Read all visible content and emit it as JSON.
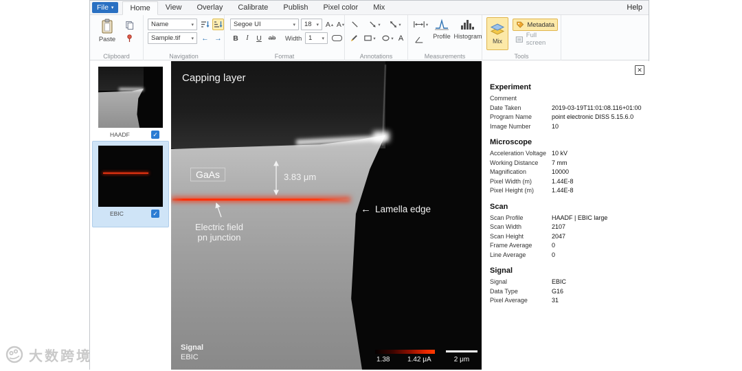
{
  "window": {
    "help_label": "Help"
  },
  "icons": {
    "caret": "▾",
    "caret_up": "▴",
    "arrow_left": "←",
    "arrow_right": "→",
    "check": "✓",
    "close": "✕"
  },
  "file_menu": {
    "label": "File"
  },
  "tabs": {
    "items": [
      "Home",
      "View",
      "Overlay",
      "Calibrate",
      "Publish",
      "Pixel color",
      "Mix"
    ],
    "active": "Home"
  },
  "ribbon": {
    "clipboard": {
      "group_label": "Clipboard",
      "paste_label": "Paste"
    },
    "navigation": {
      "group_label": "Navigation",
      "sort_field": "Name",
      "file_name": "Sample.tif"
    },
    "format": {
      "group_label": "Format",
      "font_family": "Segoe UI",
      "font_size": "18",
      "bold": "B",
      "italic": "I",
      "underline": "U",
      "strikethrough": "ab",
      "grow": "A",
      "shrink": "A",
      "width_label": "Width",
      "width_value": "1"
    },
    "annotations": {
      "group_label": "Annotations",
      "text_tool": "A"
    },
    "measurements": {
      "group_label": "Measurements",
      "profile_label": "Profile",
      "histogram_label": "Histogram"
    },
    "tools": {
      "group_label": "Tools",
      "mix_label": "Mix",
      "metadata_label": "Metadata",
      "fullscreen_label": "Full screen"
    }
  },
  "thumbnails": [
    {
      "name": "HAADF",
      "checked": true,
      "selected": false
    },
    {
      "name": "EBIC",
      "checked": true,
      "selected": true
    }
  ],
  "image": {
    "capping_label": "Capping layer",
    "gaas_label": "GaAs",
    "measurement_value": "3.83 μm",
    "efield_line1": "Electric field",
    "efield_line2": "pn junction",
    "lamella_label": "Lamella edge",
    "signal_title": "Signal",
    "signal_value": "EBIC",
    "colorbar_min": "1.38",
    "colorbar_max": "1.42 μA",
    "scalebar_label": "2 μm"
  },
  "metadata_panel": {
    "sections": [
      {
        "title": "Experiment",
        "rows": [
          {
            "label": "Comment",
            "value": ""
          },
          {
            "label": "Date Taken",
            "value": "2019-03-19T11:01:08.116+01:00"
          },
          {
            "label": "Program Name",
            "value": "point electronic DISS 5.15.6.0"
          },
          {
            "label": "Image Number",
            "value": "10"
          }
        ]
      },
      {
        "title": "Microscope",
        "rows": [
          {
            "label": "Acceleration Voltage",
            "value": "10 kV"
          },
          {
            "label": "Working Distance",
            "value": "7 mm"
          },
          {
            "label": "Magnification",
            "value": "10000"
          },
          {
            "label": "Pixel Width (m)",
            "value": "1.44E-8"
          },
          {
            "label": "Pixel Height (m)",
            "value": "1.44E-8"
          }
        ]
      },
      {
        "title": "Scan",
        "rows": [
          {
            "label": "Scan Profile",
            "value": "HAADF | EBIC large"
          },
          {
            "label": "Scan Width",
            "value": "2107"
          },
          {
            "label": "Scan Height",
            "value": "2047"
          },
          {
            "label": "Frame Average",
            "value": "0"
          },
          {
            "label": "Line Average",
            "value": "0"
          }
        ]
      },
      {
        "title": "Signal",
        "rows": [
          {
            "label": "Signal",
            "value": "EBIC"
          },
          {
            "label": "Data Type",
            "value": "G16"
          },
          {
            "label": "Pixel Average",
            "value": "31"
          }
        ]
      }
    ]
  },
  "watermark": {
    "text": "大数跨境"
  }
}
